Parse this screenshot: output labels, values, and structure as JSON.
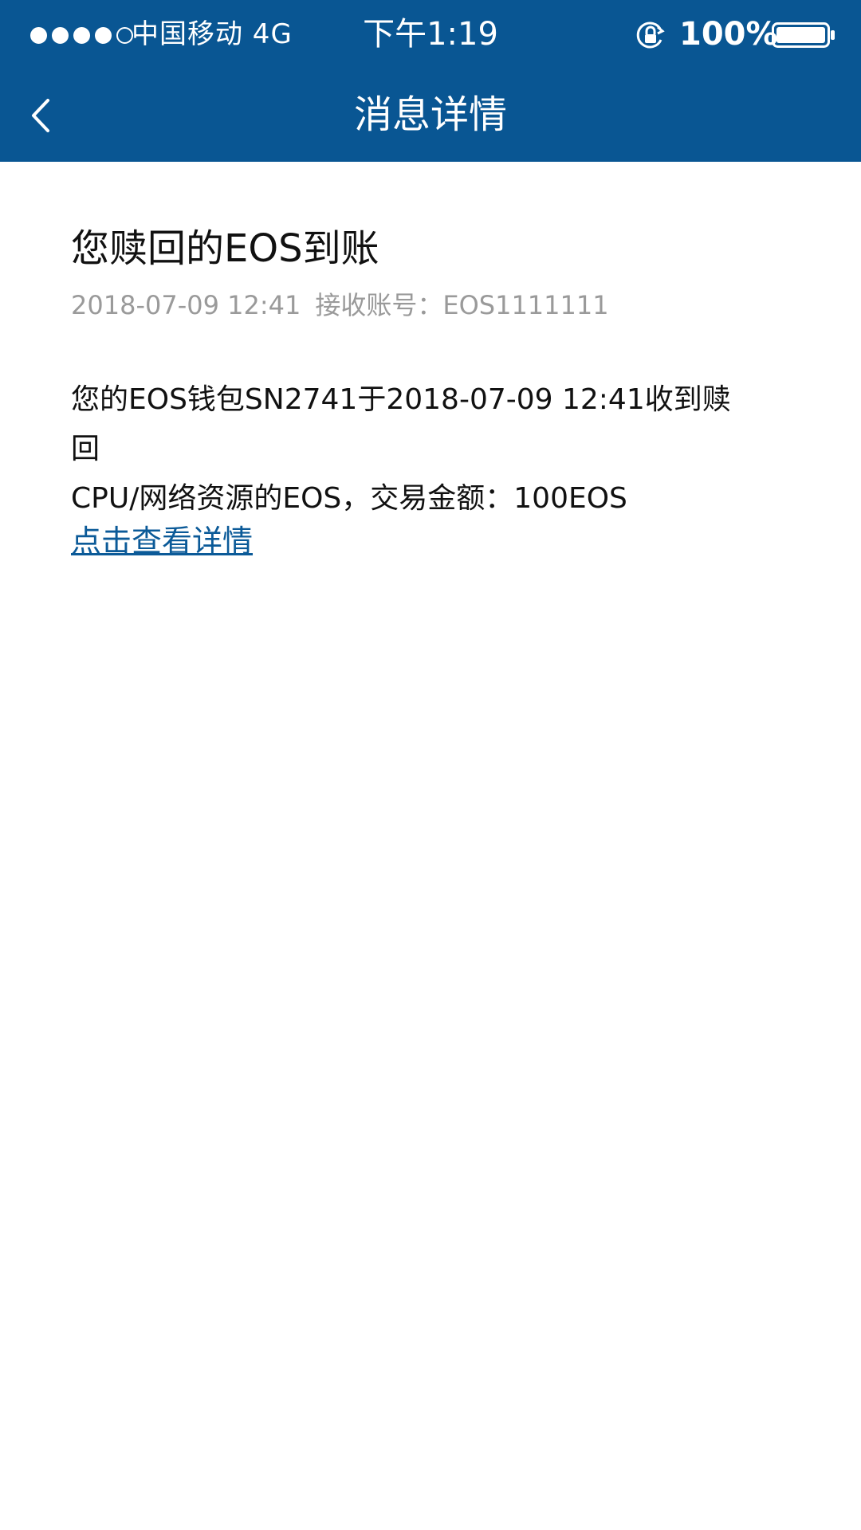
{
  "status_bar": {
    "signal_bars": 5,
    "signal_filled": 4,
    "carrier": "中国移动 4G",
    "time": "下午1:19",
    "battery": "100%",
    "battery_level": 1.0,
    "rotation_icon": "rotation-lock-icon",
    "battery_icon": "battery-icon"
  },
  "nav": {
    "back_icon": "chevron-left-icon",
    "title": "消息详情"
  },
  "message": {
    "title": "您赎回的EOS到账",
    "date": "2018-07-09 12:41",
    "account": "接收账号：EOS1111111",
    "body_line1": "您的EOS钱包SN2741于2018-07-09 12:41收到赎回",
    "body_line2": "CPU/网络资源的EOS，交易金额：100EOS",
    "link": "点击查看详情"
  },
  "colors": {
    "header_bg": "#095693",
    "link": "#0b5a98",
    "meta_text": "#9a9a9a",
    "body_text": "#111111"
  }
}
